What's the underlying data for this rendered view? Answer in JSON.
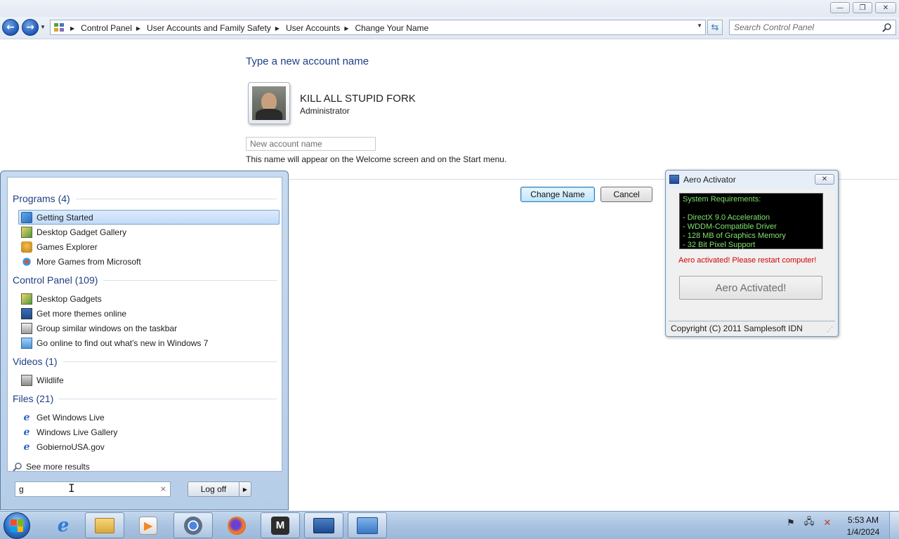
{
  "window": {
    "minimize_glyph": "—",
    "maximize_glyph": "❐",
    "close_glyph": "✕"
  },
  "nav": {
    "back_glyph": "←",
    "forward_glyph": "→",
    "breadcrumbs": [
      "Control Panel",
      "User Accounts and Family Safety",
      "User Accounts",
      "Change Your Name"
    ],
    "search_placeholder": "Search Control Panel"
  },
  "main": {
    "heading": "Type a new account name",
    "user_name": "KILL ALL STUPID FORK",
    "user_role": "Administrator",
    "new_name_placeholder": "New account name",
    "hint": "This name will appear on the Welcome screen and on the Start menu.",
    "change_button": "Change Name",
    "cancel_button": "Cancel"
  },
  "start_menu": {
    "sections": [
      {
        "title": "Programs (4)",
        "items": [
          {
            "label": "Getting Started",
            "icon": "getting-started-icon",
            "selected": true
          },
          {
            "label": "Desktop Gadget Gallery",
            "icon": "gadget-gallery-icon"
          },
          {
            "label": "Games Explorer",
            "icon": "games-explorer-icon"
          },
          {
            "label": "More Games from Microsoft",
            "icon": "more-games-icon"
          }
        ]
      },
      {
        "title": "Control Panel (109)",
        "items": [
          {
            "label": "Desktop Gadgets",
            "icon": "desktop-gadgets-icon"
          },
          {
            "label": "Get more themes online",
            "icon": "themes-icon"
          },
          {
            "label": "Group similar windows on the taskbar",
            "icon": "taskbar-settings-icon"
          },
          {
            "label": "Go online to find out what's new in Windows 7",
            "icon": "whats-new-icon"
          }
        ]
      },
      {
        "title": "Videos (1)",
        "items": [
          {
            "label": "Wildlife",
            "icon": "video-file-icon"
          }
        ]
      },
      {
        "title": "Files (21)",
        "items": [
          {
            "label": "Get Windows Live",
            "icon": "ie-link-icon"
          },
          {
            "label": "Windows Live Gallery",
            "icon": "ie-link-icon"
          },
          {
            "label": "GobiernoUSA.gov",
            "icon": "ie-link-icon"
          }
        ]
      }
    ],
    "see_more": "See more results",
    "search_value": "g",
    "clear_glyph": "×",
    "logoff_label": "Log off"
  },
  "aero": {
    "title": "Aero Activator",
    "requirements_title": "System Requirements:",
    "requirements": [
      "- DirectX 9.0 Acceleration",
      "- WDDM-Compatible Driver",
      "- 128 MB of Graphics Memory",
      "- 32 Bit Pixel Support"
    ],
    "status": "Aero activated! Please restart computer!",
    "button": "Aero Activated!",
    "footer": "Copyright (C) 2011 Samplesoft IDN"
  },
  "taskbar": {
    "pinned": [
      {
        "name": "internet-explorer-icon",
        "glyph": "e",
        "color": "#2f7ad6",
        "running": false
      },
      {
        "name": "file-explorer-icon",
        "glyph": "",
        "color": "#e8c25a",
        "running": true
      },
      {
        "name": "media-player-icon",
        "glyph": "▶",
        "color": "#f08a24",
        "running": false
      },
      {
        "name": "chrome-icon",
        "glyph": "",
        "color": "#4a86e8",
        "running": true
      },
      {
        "name": "firefox-icon",
        "glyph": "",
        "color": "#e8601c",
        "running": false
      },
      {
        "name": "m-app-icon",
        "glyph": "M",
        "color": "#2d2d2d",
        "running": true
      },
      {
        "name": "presentation-app-icon",
        "glyph": "",
        "color": "#2d5ea8",
        "running": true
      },
      {
        "name": "control-panel-icon",
        "glyph": "",
        "color": "#4f8fd6",
        "running": true
      }
    ],
    "clock_time": "5:53 AM",
    "clock_date": "1/4/2024"
  }
}
